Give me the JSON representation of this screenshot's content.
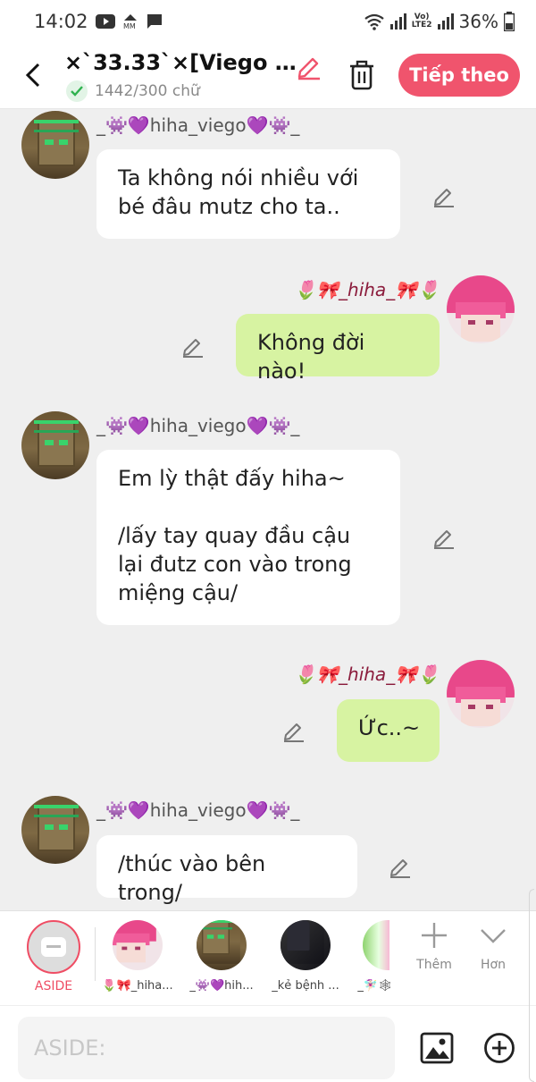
{
  "status": {
    "time": "14:02",
    "battery": "36%",
    "net_top": "Vo)",
    "net_bottom": "LTE2"
  },
  "header": {
    "title": "×`33.33`×[Viego x h…",
    "word_count": "1442/300 chữ",
    "next_label": "Tiếp theo"
  },
  "colors": {
    "accent": "#f0546d",
    "bubble_self": "#d7f3a2",
    "bubble_other": "#ffffff"
  },
  "messages": [
    {
      "side": "left",
      "name": "_👾💜hiha_viego💜👾_",
      "text": "Ta không nói nhiều với\nbé đâu mutz cho ta.."
    },
    {
      "side": "right",
      "name": "🌷🎀_hiha_🎀🌷",
      "text": "Không đời nào!"
    },
    {
      "side": "left",
      "name": "_👾💜hiha_viego💜👾_",
      "text": "Em lỳ thật đấy hiha~\n\n/lấy tay quay đầu cậu\nlại đutz con vào trong\nmiệng cậu/"
    },
    {
      "side": "right",
      "name": "🌷🎀_hiha_🎀🌷",
      "text": "Ức..~"
    },
    {
      "side": "left",
      "name": "_👾💜hiha_viego💜👾_",
      "text": "/thúc vào bên trong/"
    }
  ],
  "tray": {
    "aside_label": "ASIDE",
    "characters": [
      {
        "label": "🌷🎀_hiha..."
      },
      {
        "label": "_👾💜hih..."
      },
      {
        "label": "_kẻ bệnh ..."
      },
      {
        "label": "_🧚🏻‍♀️🕸"
      }
    ],
    "more_label": "Thêm",
    "less_label": "Hơn"
  },
  "composer": {
    "placeholder": "ASIDE:"
  }
}
